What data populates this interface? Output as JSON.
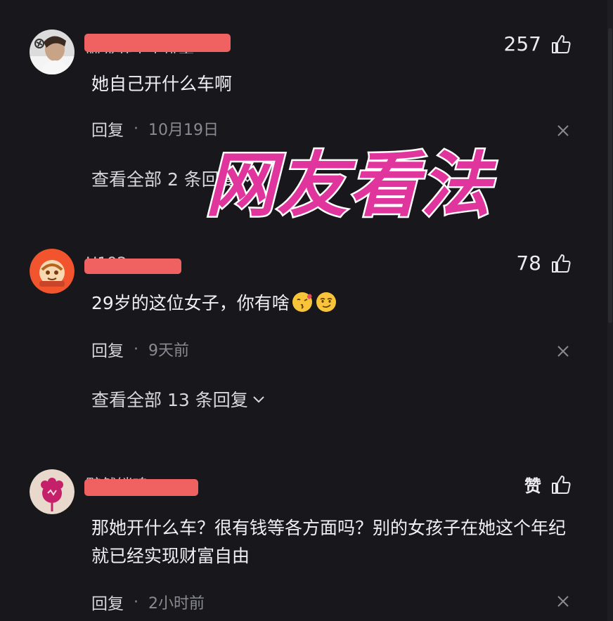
{
  "overlay": {
    "title": "网友看法",
    "color": "#e0359c",
    "outline": "#ffffff"
  },
  "comments": [
    {
      "name_peek": "阿龙开了个玩笑",
      "likes": "257",
      "text": "她自己开什么车啊",
      "reply_label": "回复",
      "time": "10月19日",
      "view_replies": "查看全部 2 条回复"
    },
    {
      "name_peek": "H192",
      "likes": "78",
      "text": "29岁的这位女子，你有啥",
      "reply_label": "回复",
      "time": "9天前",
      "view_replies": "查看全部 13 条回复"
    },
    {
      "name_peek": "黯然销魂",
      "likes": "赞",
      "text": "那她开什么车？很有钱等各方面吗？别的女孩子在她这个年纪就已经实现财富自由",
      "reply_label": "回复",
      "time": "2小时前"
    }
  ],
  "icons": {
    "like": "thumbs-up-icon",
    "close": "close-icon",
    "chevron": "chevron-down-icon",
    "emoji1": "kissing-face-emoji",
    "emoji2": "smirking-face-emoji"
  },
  "colors": {
    "background": "#17171c",
    "redaction": "#f06262",
    "meta_text": "#8a8a92"
  }
}
